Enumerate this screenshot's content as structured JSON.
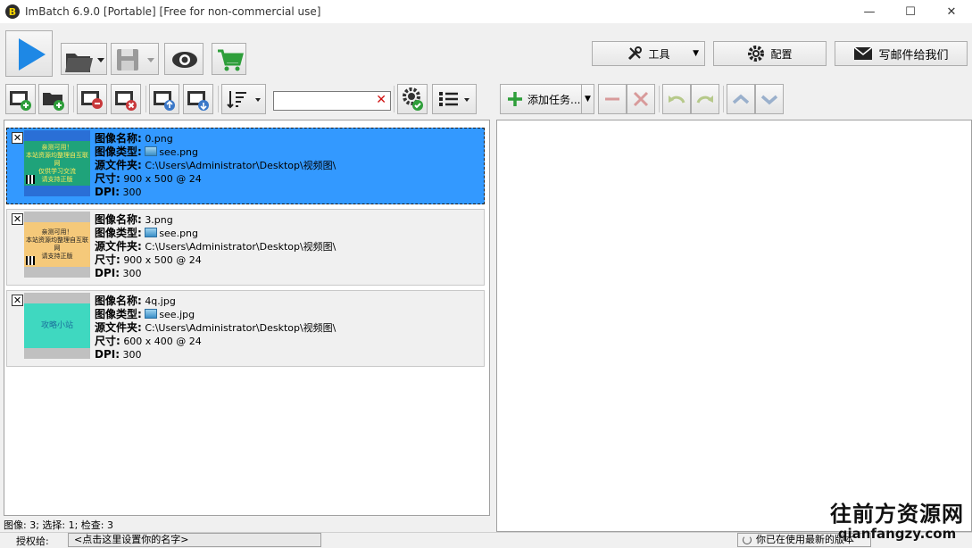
{
  "window": {
    "title": "ImBatch 6.9.0 [Portable] [Free for non-commercial use]",
    "app_icon_letter": "B",
    "controls": [
      "—",
      "☐",
      "✕"
    ]
  },
  "toolbar_right": {
    "tools_label": "工具",
    "config_label": "配置",
    "email_label": "写邮件给我们"
  },
  "search": {
    "value": "",
    "clear_symbol": "✕"
  },
  "task_toolbar": {
    "add_task_label": "添加任务..."
  },
  "images": [
    {
      "name_label": "图像名称:",
      "name": "0.png",
      "type_label": "图像类型:",
      "type": "see.png",
      "folder_label": "源文件夹:",
      "folder": "C:\\Users\\Administrator\\Desktop\\视频图\\",
      "size_label": "尺寸:",
      "size": "900 x 500 @ 24",
      "dpi_label": "DPI:",
      "dpi": "300",
      "checked": "✕",
      "thumb_text": "亲测可用！\n本站资源均整理自互联网\n仅供学习交流\n请支持正版",
      "thumb_bg": "#1fa37a"
    },
    {
      "name_label": "图像名称:",
      "name": "3.png",
      "type_label": "图像类型:",
      "type": "see.png",
      "folder_label": "源文件夹:",
      "folder": "C:\\Users\\Administrator\\Desktop\\视频图\\",
      "size_label": "尺寸:",
      "size": "900 x 500 @ 24",
      "dpi_label": "DPI:",
      "dpi": "300",
      "checked": "✕",
      "thumb_text": "亲测可用！\n本站资源均整理自互联网\n请支持正版",
      "thumb_bg": "#f5c97a"
    },
    {
      "name_label": "图像名称:",
      "name": "4q.jpg",
      "type_label": "图像类型:",
      "type": "see.jpg",
      "folder_label": "源文件夹:",
      "folder": "C:\\Users\\Administrator\\Desktop\\视频图\\",
      "size_label": "尺寸:",
      "size": "600 x 400 @ 24",
      "dpi_label": "DPI:",
      "dpi": "300",
      "checked": "✕",
      "thumb_text": "攻略小站",
      "thumb_bg": "#3fd8c0"
    }
  ],
  "status": {
    "summary": "图像: 3; 选择: 1; 检查: 3",
    "license_label": "授权给:",
    "license_value": "<点击这里设置你的名字>",
    "update_note": "你已在使用最新的版本"
  },
  "watermark": {
    "line1": "往前方资源网",
    "line2": "qianfangzy.com"
  },
  "colors": {
    "accent": "#3399ff",
    "play": "#1e88e5",
    "green": "#2e9e3a",
    "red": "#c8383a"
  }
}
